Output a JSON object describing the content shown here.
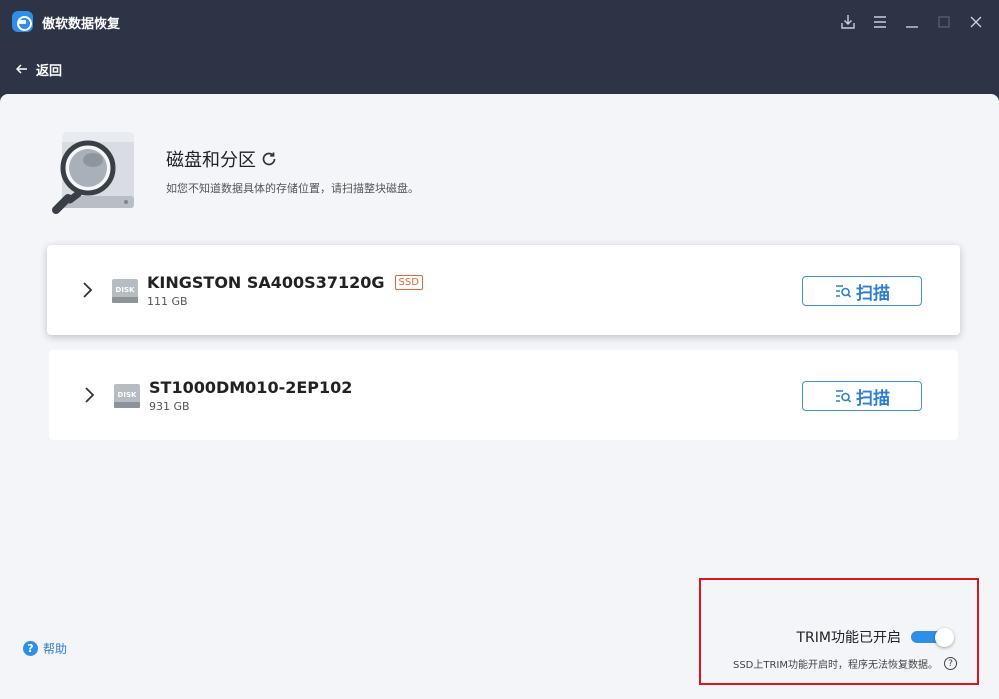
{
  "app": {
    "title": "傲软数据恢复"
  },
  "nav": {
    "back_label": "返回"
  },
  "section": {
    "title": "磁盘和分区",
    "description": "如您不知道数据具体的存储位置，请扫描整块磁盘。"
  },
  "disks": [
    {
      "name": "KINGSTON SA400S37120G",
      "badge": "SSD",
      "size": "111 GB",
      "scan_label": "扫描",
      "icon_text": "DISK"
    },
    {
      "name": "ST1000DM010-2EP102",
      "badge": "",
      "size": "931 GB",
      "scan_label": "扫描",
      "icon_text": "DISK"
    }
  ],
  "footer": {
    "help_label": "帮助",
    "help_icon": "?",
    "trim_label": "TRIM功能已开启",
    "trim_enabled": true,
    "trim_note": "SSD上TRIM功能开启时，程序无法恢复数据。",
    "note_icon": "?"
  },
  "colors": {
    "titlebar": "#2c3446",
    "accent": "#2f8fe8",
    "ssd_badge": "#e0673a",
    "highlight_box": "#d8161d"
  }
}
